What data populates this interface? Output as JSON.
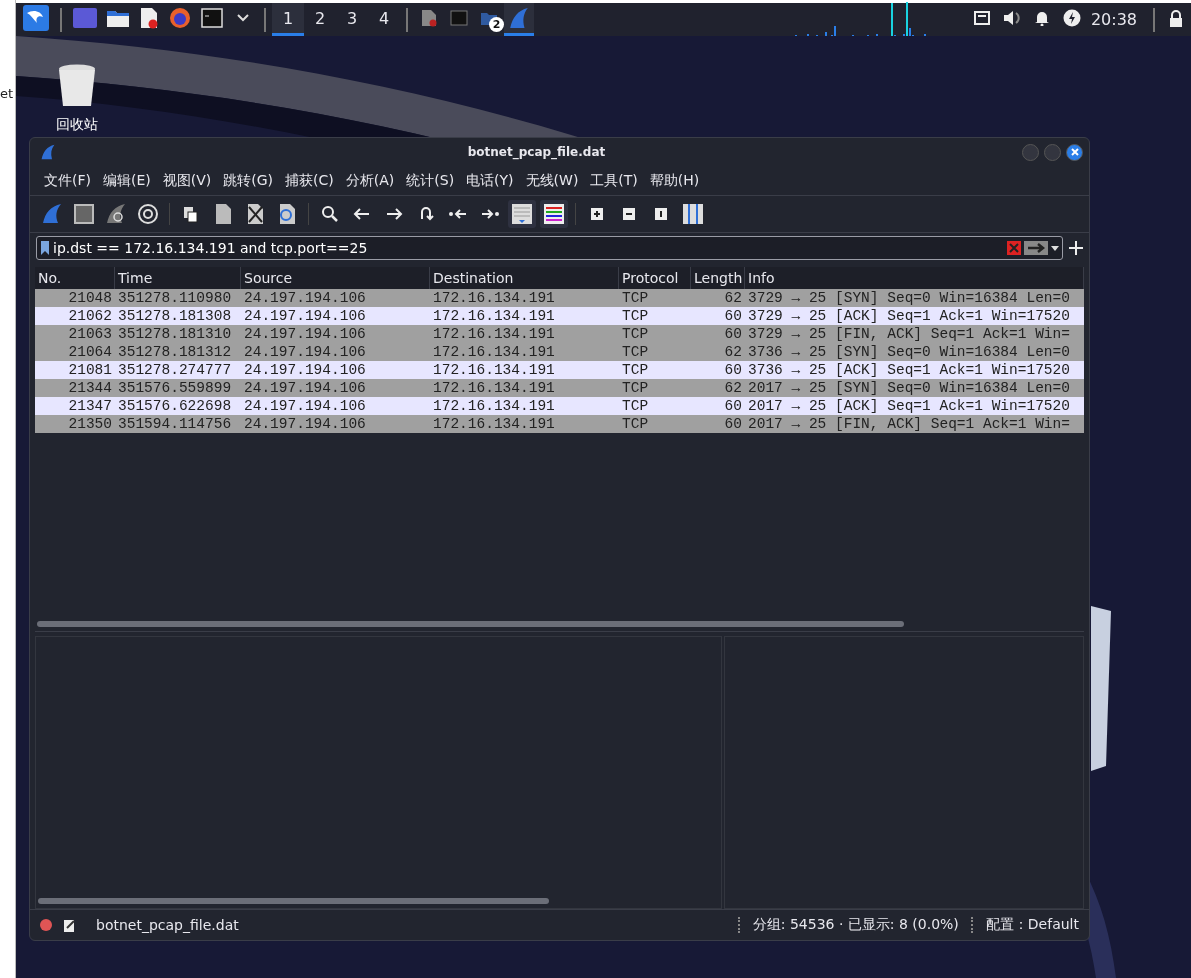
{
  "side_window": {
    "text": "et"
  },
  "taskbar": {
    "workspaces": [
      {
        "label": "1",
        "selected": true
      },
      {
        "label": "2",
        "selected": false
      },
      {
        "label": "3",
        "selected": false
      },
      {
        "label": "4",
        "selected": false
      }
    ],
    "tasks": [
      {
        "kind": "document",
        "selected": false
      },
      {
        "kind": "terminal",
        "selected": false
      },
      {
        "kind": "folder",
        "selected": false,
        "badge": "2"
      },
      {
        "kind": "shark",
        "selected": true
      }
    ],
    "clock": "20:38"
  },
  "desktop": {
    "icons": [
      {
        "label": "回收站"
      }
    ]
  },
  "window": {
    "title": "botnet_pcap_file.dat",
    "menu": [
      "文件(F)",
      "编辑(E)",
      "视图(V)",
      "跳转(G)",
      "捕获(C)",
      "分析(A)",
      "统计(S)",
      "电话(Y)",
      "无线(W)",
      "工具(T)",
      "帮助(H)"
    ],
    "filter": {
      "value": "ip.dst == 172.16.134.191 and tcp.port==25"
    },
    "packet_list": {
      "columns": [
        "No.",
        "Time",
        "Source",
        "Destination",
        "Protocol",
        "Length",
        "Info"
      ],
      "rows": [
        {
          "cells": [
            "21048",
            "351278.110980",
            "24.197.194.106",
            "172.16.134.191",
            "TCP",
            "62",
            "3729 → 25 [SYN] Seq=0 Win=16384 Len=0"
          ],
          "color": "#a0a0a0"
        },
        {
          "cells": [
            "21062",
            "351278.181308",
            "24.197.194.106",
            "172.16.134.191",
            "TCP",
            "60",
            "3729 → 25 [ACK] Seq=1 Ack=1 Win=17520"
          ],
          "color": "#e7e6ff"
        },
        {
          "cells": [
            "21063",
            "351278.181310",
            "24.197.194.106",
            "172.16.134.191",
            "TCP",
            "60",
            "3729 → 25 [FIN, ACK] Seq=1 Ack=1 Win="
          ],
          "color": "#a0a0a0"
        },
        {
          "cells": [
            "21064",
            "351278.181312",
            "24.197.194.106",
            "172.16.134.191",
            "TCP",
            "62",
            "3736 → 25 [SYN] Seq=0 Win=16384 Len=0"
          ],
          "color": "#a0a0a0"
        },
        {
          "cells": [
            "21081",
            "351278.274777",
            "24.197.194.106",
            "172.16.134.191",
            "TCP",
            "60",
            "3736 → 25 [ACK] Seq=1 Ack=1 Win=17520"
          ],
          "color": "#e7e6ff"
        },
        {
          "cells": [
            "21344",
            "351576.559899",
            "24.197.194.106",
            "172.16.134.191",
            "TCP",
            "62",
            "2017 → 25 [SYN] Seq=0 Win=16384 Len=0"
          ],
          "color": "#a0a0a0"
        },
        {
          "cells": [
            "21347",
            "351576.622698",
            "24.197.194.106",
            "172.16.134.191",
            "TCP",
            "60",
            "2017 → 25 [ACK] Seq=1 Ack=1 Win=17520"
          ],
          "color": "#e7e6ff"
        },
        {
          "cells": [
            "21350",
            "351594.114756",
            "24.197.194.106",
            "172.16.134.191",
            "TCP",
            "60",
            "2017 → 25 [FIN, ACK] Seq=1 Ack=1 Win="
          ],
          "color": "#a0a0a0"
        }
      ]
    },
    "status_bar": {
      "file": "botnet_pcap_file.dat",
      "packets": "分组: 54536 · 已显示: 8 (0.0%)",
      "profile": "配置：Default"
    }
  }
}
